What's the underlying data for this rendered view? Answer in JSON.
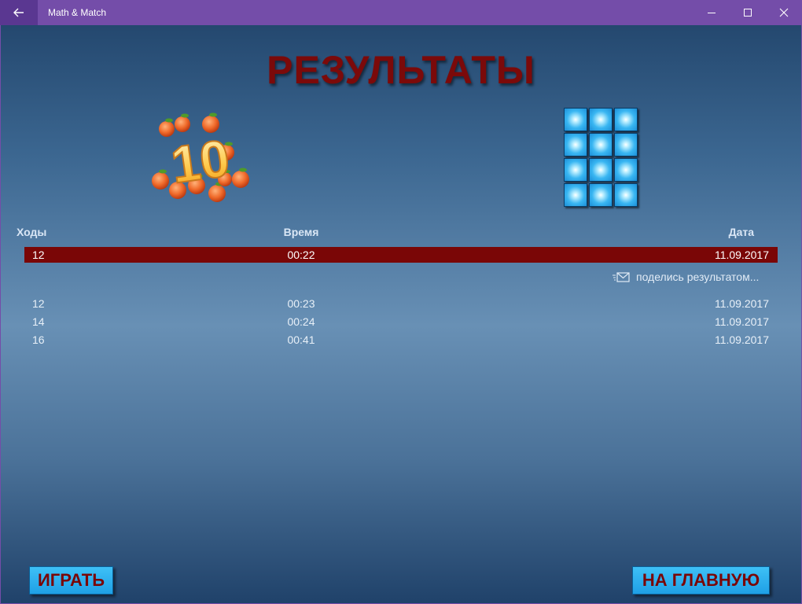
{
  "window": {
    "app_title": "Math & Match",
    "back_icon": "back-arrow-icon",
    "minimize_icon": "minimize-icon",
    "maximize_icon": "maximize-icon",
    "close_icon": "close-icon",
    "accent_color": "#744da9"
  },
  "page": {
    "title": "РЕЗУЛЬТАТЫ",
    "title_color": "#7b0a0a"
  },
  "logo": {
    "number": "10",
    "icon": "apples-ten-logo"
  },
  "grid_icon": {
    "icon": "tile-grid-3x4-icon",
    "columns": 3,
    "rows": 4
  },
  "table": {
    "headers": {
      "moves": "Ходы",
      "time": "Время",
      "date": "Дата"
    },
    "current": {
      "moves": "12",
      "time": "00:22",
      "date": "11.09.2017"
    },
    "rows": [
      {
        "moves": "12",
        "time": "00:23",
        "date": "11.09.2017"
      },
      {
        "moves": "14",
        "time": "00:24",
        "date": "11.09.2017"
      },
      {
        "moves": "16",
        "time": "00:41",
        "date": "11.09.2017"
      }
    ],
    "highlight_color": "#7a0606"
  },
  "share": {
    "label": "поделись результатом...",
    "icon": "share-mail-icon"
  },
  "buttons": {
    "play": "ИГРАТЬ",
    "home": "НА ГЛАВНУЮ"
  }
}
